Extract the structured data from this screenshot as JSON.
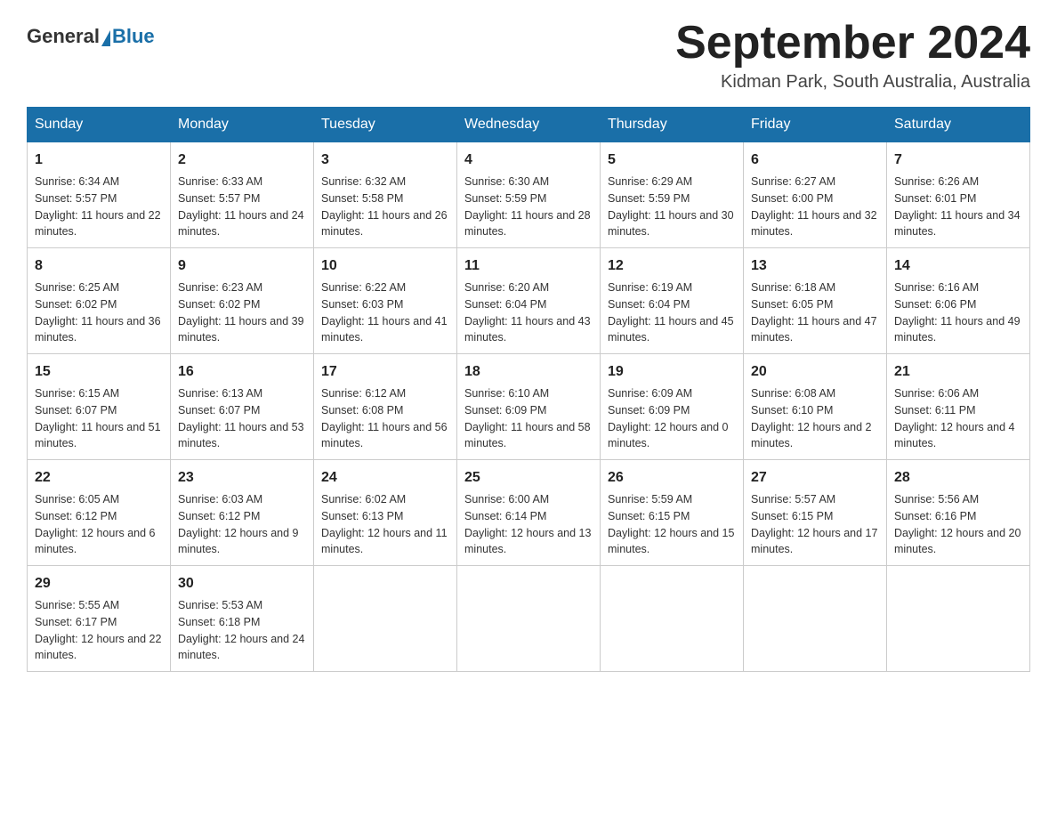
{
  "header": {
    "logo_general": "General",
    "logo_blue": "Blue",
    "month_title": "September 2024",
    "location": "Kidman Park, South Australia, Australia"
  },
  "weekdays": [
    "Sunday",
    "Monday",
    "Tuesday",
    "Wednesday",
    "Thursday",
    "Friday",
    "Saturday"
  ],
  "weeks": [
    [
      {
        "day": "1",
        "sunrise": "6:34 AM",
        "sunset": "5:57 PM",
        "daylight": "11 hours and 22 minutes."
      },
      {
        "day": "2",
        "sunrise": "6:33 AM",
        "sunset": "5:57 PM",
        "daylight": "11 hours and 24 minutes."
      },
      {
        "day": "3",
        "sunrise": "6:32 AM",
        "sunset": "5:58 PM",
        "daylight": "11 hours and 26 minutes."
      },
      {
        "day": "4",
        "sunrise": "6:30 AM",
        "sunset": "5:59 PM",
        "daylight": "11 hours and 28 minutes."
      },
      {
        "day": "5",
        "sunrise": "6:29 AM",
        "sunset": "5:59 PM",
        "daylight": "11 hours and 30 minutes."
      },
      {
        "day": "6",
        "sunrise": "6:27 AM",
        "sunset": "6:00 PM",
        "daylight": "11 hours and 32 minutes."
      },
      {
        "day": "7",
        "sunrise": "6:26 AM",
        "sunset": "6:01 PM",
        "daylight": "11 hours and 34 minutes."
      }
    ],
    [
      {
        "day": "8",
        "sunrise": "6:25 AM",
        "sunset": "6:02 PM",
        "daylight": "11 hours and 36 minutes."
      },
      {
        "day": "9",
        "sunrise": "6:23 AM",
        "sunset": "6:02 PM",
        "daylight": "11 hours and 39 minutes."
      },
      {
        "day": "10",
        "sunrise": "6:22 AM",
        "sunset": "6:03 PM",
        "daylight": "11 hours and 41 minutes."
      },
      {
        "day": "11",
        "sunrise": "6:20 AM",
        "sunset": "6:04 PM",
        "daylight": "11 hours and 43 minutes."
      },
      {
        "day": "12",
        "sunrise": "6:19 AM",
        "sunset": "6:04 PM",
        "daylight": "11 hours and 45 minutes."
      },
      {
        "day": "13",
        "sunrise": "6:18 AM",
        "sunset": "6:05 PM",
        "daylight": "11 hours and 47 minutes."
      },
      {
        "day": "14",
        "sunrise": "6:16 AM",
        "sunset": "6:06 PM",
        "daylight": "11 hours and 49 minutes."
      }
    ],
    [
      {
        "day": "15",
        "sunrise": "6:15 AM",
        "sunset": "6:07 PM",
        "daylight": "11 hours and 51 minutes."
      },
      {
        "day": "16",
        "sunrise": "6:13 AM",
        "sunset": "6:07 PM",
        "daylight": "11 hours and 53 minutes."
      },
      {
        "day": "17",
        "sunrise": "6:12 AM",
        "sunset": "6:08 PM",
        "daylight": "11 hours and 56 minutes."
      },
      {
        "day": "18",
        "sunrise": "6:10 AM",
        "sunset": "6:09 PM",
        "daylight": "11 hours and 58 minutes."
      },
      {
        "day": "19",
        "sunrise": "6:09 AM",
        "sunset": "6:09 PM",
        "daylight": "12 hours and 0 minutes."
      },
      {
        "day": "20",
        "sunrise": "6:08 AM",
        "sunset": "6:10 PM",
        "daylight": "12 hours and 2 minutes."
      },
      {
        "day": "21",
        "sunrise": "6:06 AM",
        "sunset": "6:11 PM",
        "daylight": "12 hours and 4 minutes."
      }
    ],
    [
      {
        "day": "22",
        "sunrise": "6:05 AM",
        "sunset": "6:12 PM",
        "daylight": "12 hours and 6 minutes."
      },
      {
        "day": "23",
        "sunrise": "6:03 AM",
        "sunset": "6:12 PM",
        "daylight": "12 hours and 9 minutes."
      },
      {
        "day": "24",
        "sunrise": "6:02 AM",
        "sunset": "6:13 PM",
        "daylight": "12 hours and 11 minutes."
      },
      {
        "day": "25",
        "sunrise": "6:00 AM",
        "sunset": "6:14 PM",
        "daylight": "12 hours and 13 minutes."
      },
      {
        "day": "26",
        "sunrise": "5:59 AM",
        "sunset": "6:15 PM",
        "daylight": "12 hours and 15 minutes."
      },
      {
        "day": "27",
        "sunrise": "5:57 AM",
        "sunset": "6:15 PM",
        "daylight": "12 hours and 17 minutes."
      },
      {
        "day": "28",
        "sunrise": "5:56 AM",
        "sunset": "6:16 PM",
        "daylight": "12 hours and 20 minutes."
      }
    ],
    [
      {
        "day": "29",
        "sunrise": "5:55 AM",
        "sunset": "6:17 PM",
        "daylight": "12 hours and 22 minutes."
      },
      {
        "day": "30",
        "sunrise": "5:53 AM",
        "sunset": "6:18 PM",
        "daylight": "12 hours and 24 minutes."
      },
      null,
      null,
      null,
      null,
      null
    ]
  ],
  "labels": {
    "sunrise_prefix": "Sunrise: ",
    "sunset_prefix": "Sunset: ",
    "daylight_prefix": "Daylight: "
  }
}
